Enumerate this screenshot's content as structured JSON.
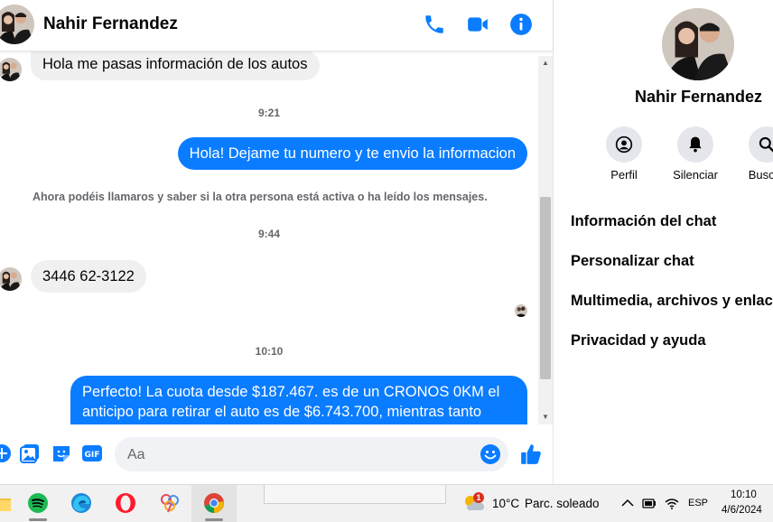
{
  "contact": {
    "name": "Nahir Fernandez"
  },
  "messages": [
    {
      "kind": "in",
      "text": "Hola me pasas información de los autos"
    },
    {
      "kind": "time",
      "text": "9:21"
    },
    {
      "kind": "out",
      "text": "Hola! Dejame tu numero y te envio la informacion"
    },
    {
      "kind": "notice",
      "text": "Ahora podéis llamaros y saber si la otra persona está activa o ha leído los mensajes."
    },
    {
      "kind": "time",
      "text": "9:44"
    },
    {
      "kind": "in",
      "text": "3446 62-3122"
    },
    {
      "kind": "time",
      "text": "10:10"
    },
    {
      "kind": "out",
      "text": "Perfecto! La cuota desde $187.467. es de un CRONOS 0KM el anticipo para retirar el auto es de $6.743.700, mientras tanto"
    }
  ],
  "composer": {
    "placeholder": "Aa"
  },
  "side": {
    "name": "Nahir Fernandez",
    "actions": [
      {
        "label": "Perfil"
      },
      {
        "label": "Silenciar"
      },
      {
        "label": "Buscar"
      }
    ],
    "menu": [
      {
        "label": "Información del chat"
      },
      {
        "label": "Personalizar chat"
      },
      {
        "label": "Multimedia, archivos y enlaces"
      },
      {
        "label": "Privacidad y ayuda"
      }
    ]
  },
  "taskbar": {
    "weather": {
      "temp": "10°C",
      "desc": "Parc. soleado",
      "badge": "1"
    },
    "lang": "ESP",
    "time": "10:10",
    "date": "4/6/2024"
  },
  "colors": {
    "accent": "#0a7cff",
    "incoming_bubble": "#f0f0f0",
    "muted_text": "#65676b"
  }
}
